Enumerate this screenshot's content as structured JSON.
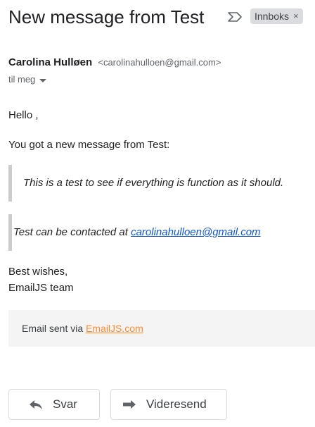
{
  "email": {
    "subject": "New message from Test",
    "label": "Innboks",
    "label_remove": "×",
    "sender_name": "Carolina Hulløen",
    "sender_email": "<carolinahulloen@gmail.com>",
    "recipient": "til meg"
  },
  "body": {
    "greeting": "Hello ,",
    "intro": "You got a new message from Test:",
    "message": "This is a test to see if everything is function as it should.",
    "contact_prefix": "Test can be contacted at ",
    "contact_email": "carolinahulloen@gmail.com",
    "signoff": "Best wishes,",
    "signature": "EmailJS team"
  },
  "footer": {
    "prefix": "Email sent via ",
    "link": "EmailJS.com"
  },
  "actions": {
    "reply": "Svar",
    "forward": "Videresend"
  }
}
